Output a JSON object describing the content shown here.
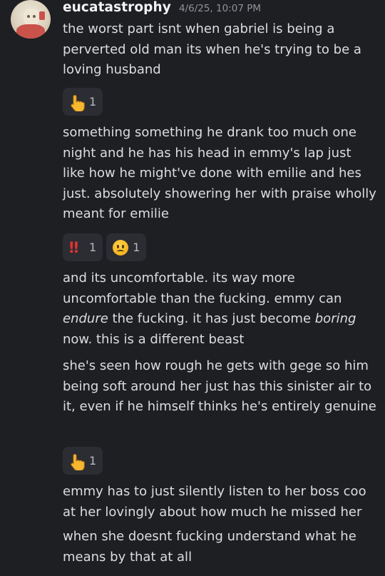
{
  "message_group": {
    "username": "eucatastrophy",
    "timestamp": "4/6/25, 10:07 PM",
    "messages": [
      {
        "text": "the worst part isnt when gabriel is being a perverted old man its when he's trying to be a loving husband"
      },
      {
        "text": "something something he drank too much one night and he has his head in emmy's lap just like how he might've done with emilie and hes just. absolutely showering her with praise wholly meant for emilie"
      },
      {
        "parts": [
          "and its uncomfortable. its way more uncomfortable than the fucking. emmy can ",
          "endure",
          " the fucking. it has just become ",
          "boring",
          " now. this is a different beast"
        ]
      },
      {
        "text": "she's seen how rough he gets with gege so him being soft around her just has this sinister air to it, even if he himself thinks he's entirely genuine"
      },
      {
        "text": "emmy has to just silently listen to her boss coo at her lovingly about how much he missed her"
      },
      {
        "text": "when she doesnt fucking understand what he means by that at all"
      }
    ]
  },
  "reactions": {
    "r1": {
      "emoji": "pointing-up-hand",
      "count": "1"
    },
    "r2a": {
      "emoji": "double-exclamation",
      "count": "1"
    },
    "r2b": {
      "emoji": "frowning-face",
      "count": "1"
    },
    "r3": {
      "emoji": "pointing-up-hand",
      "count": "1"
    }
  },
  "colors": {
    "background": "#1e1f23",
    "text": "#dcdde1",
    "username": "#f2f3f5",
    "timestamp": "#8f939a",
    "reaction_bg": "#2b2d33"
  }
}
